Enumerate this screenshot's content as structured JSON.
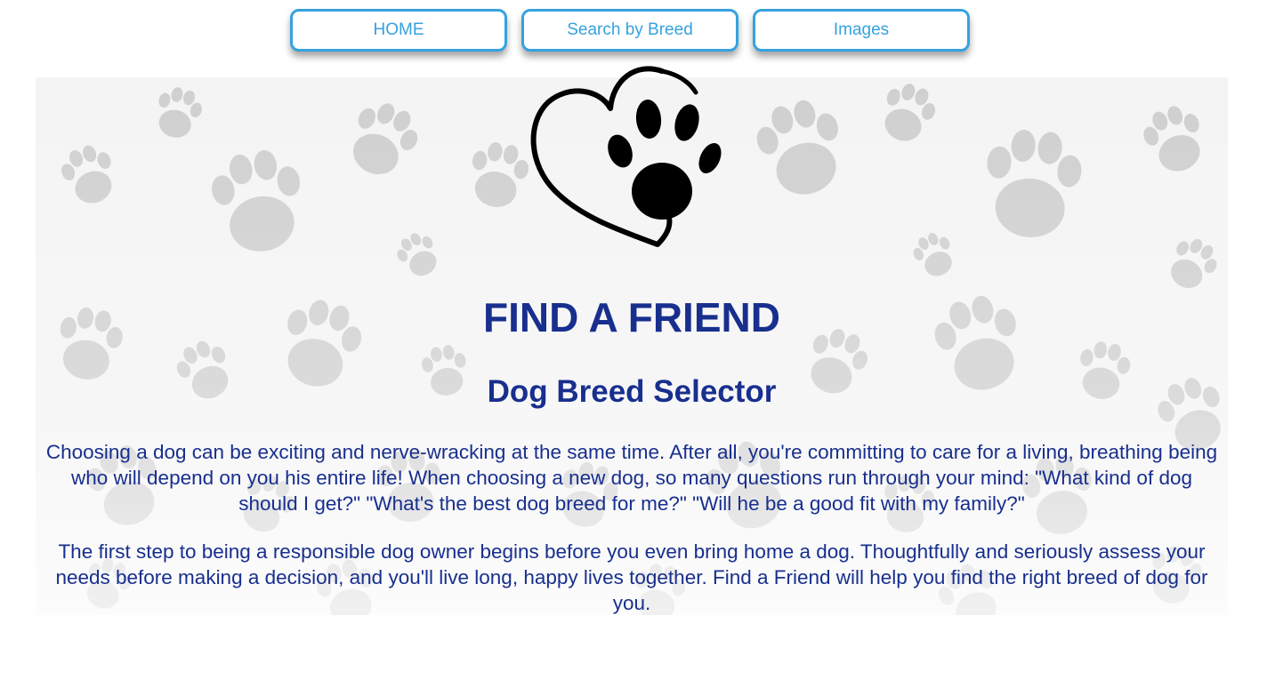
{
  "nav": {
    "home_label": "HOME",
    "search_label": "Search by Breed",
    "images_label": "Images"
  },
  "hero": {
    "logo_icon": "heart-paw-icon",
    "title": "FIND A FRIEND",
    "subtitle": "Dog Breed Selector",
    "paragraph_1": "Choosing a dog can be exciting and nerve-wracking at the same time. After all, you're committing to care for a living, breathing being who will depend on you his entire life! When choosing a new dog, so many questions run through your mind: \"What kind of dog should I get?\" \"What's the best dog breed for me?\" \"Will he be a good fit with my family?\"",
    "paragraph_2": "The first step to being a responsible dog owner begins before you even bring home a dog. Thoughtfully and seriously assess your needs before making a decision, and you'll live long, happy lives together. Find a Friend will help you find the right breed of dog for you."
  },
  "colors": {
    "accent": "#35a2df",
    "heading": "#182f8e",
    "paw_pattern": "#cfcfcf"
  }
}
